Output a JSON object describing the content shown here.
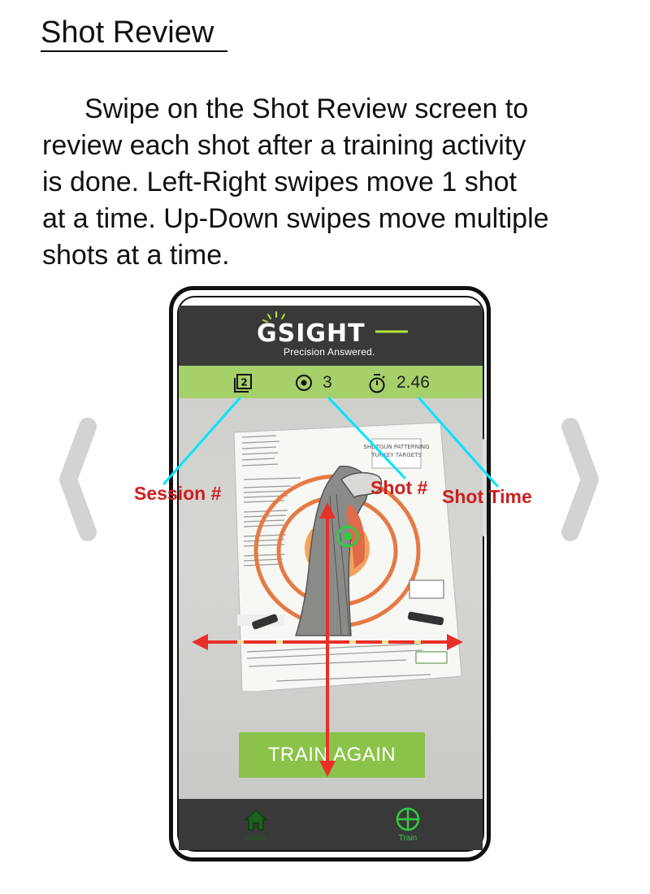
{
  "page": {
    "title": "Shot Review",
    "body_lines": [
      "Swipe on the Shot Review screen to",
      "review each shot after a training activity",
      "is done. Left-Right swipes move 1 shot",
      "at a time. Up-Down swipes move multiple",
      "shots at a time."
    ]
  },
  "app": {
    "logo_text": "GSIGHT",
    "tagline": "Precision Answered.",
    "stats": {
      "session_icon": "session-stack-icon",
      "session_value": "2",
      "shot_icon": "target-dot-icon",
      "shot_value": "3",
      "time_icon": "stopwatch-icon",
      "time_value": "2.46"
    },
    "train_again_label": "TRAIN AGAIN",
    "nav": {
      "home_label": "Home",
      "train_label": "Train"
    }
  },
  "callouts": {
    "session": "Session #",
    "shot": "Shot #",
    "shot_time": "Shot Time"
  },
  "colors": {
    "header_bg": "#3a3939",
    "stats_bar": "#a6d06a",
    "button_green": "#8bc34a",
    "nav_active": "#2ecc40",
    "callout_red": "#cc1f1f",
    "callout_line": "#00e5ff",
    "swipe_arrow": "#e8302a"
  }
}
